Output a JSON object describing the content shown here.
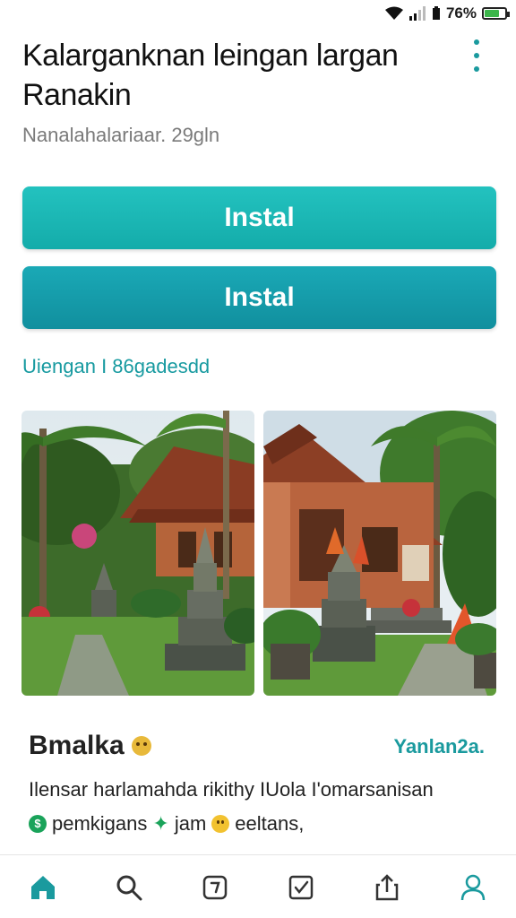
{
  "status_bar": {
    "battery_text": "76%",
    "battery_level": 0.76,
    "colors": {
      "battery": "#3bb54a"
    }
  },
  "header": {
    "title": "Kalarganknan leingan largan Ranakin",
    "subtitle": "Nanalahalariaar. 29gln",
    "more_icon": "more-vertical-icon"
  },
  "actions": {
    "install_primary_label": "Instal",
    "install_secondary_label": "Instal",
    "link_text": "Uiengan I 86gadesdd"
  },
  "screenshots": [
    {
      "icon": "screenshot-tropical-house-1"
    },
    {
      "icon": "screenshot-tropical-house-2"
    }
  ],
  "review": {
    "author": "Bmalka",
    "link": "Yanlan2a.",
    "line1": "Ilensar harlamahda rikithy IUola I'omarsanisan",
    "line2_parts": [
      "pemkigans",
      "jam",
      "eeltans,"
    ]
  },
  "bottom_nav": [
    {
      "icon": "home-icon",
      "active": true
    },
    {
      "icon": "search-icon",
      "active": false
    },
    {
      "icon": "note-icon",
      "active": false
    },
    {
      "icon": "checkbox-icon",
      "active": false
    },
    {
      "icon": "share-icon",
      "active": false
    },
    {
      "icon": "profile-icon",
      "active": false
    }
  ],
  "colors": {
    "accent": "#1a9a9e",
    "button_primary": "#1cb8b5",
    "button_secondary": "#149cab"
  }
}
